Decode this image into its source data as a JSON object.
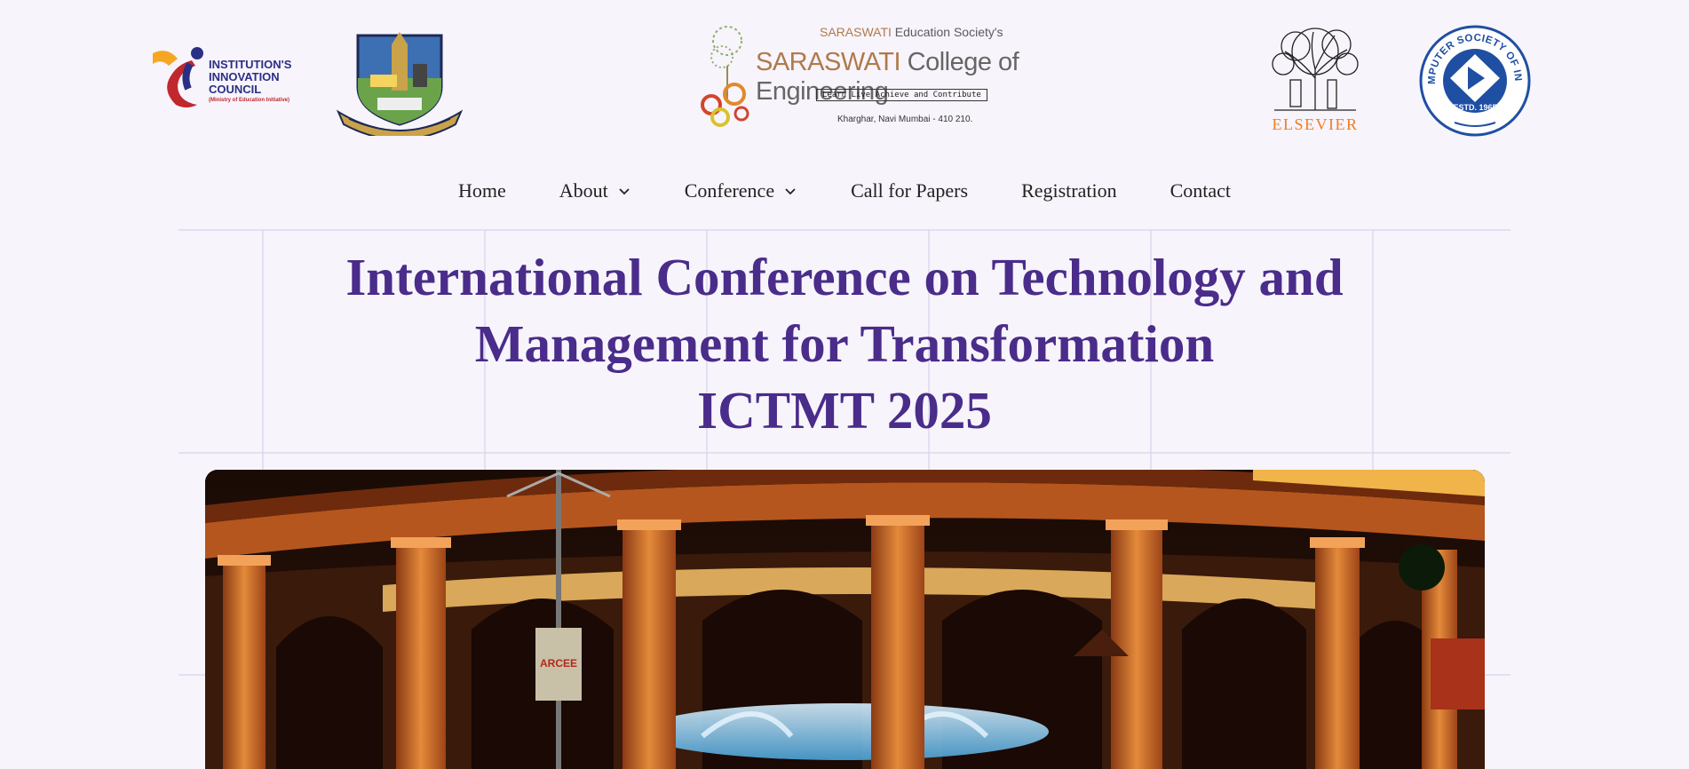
{
  "header": {
    "logos": {
      "iic": {
        "lines": [
          "INSTITUTION'S",
          "INNOVATION",
          "COUNCIL"
        ],
        "sub": "(Ministry of Education Initiative)"
      },
      "university_crest": "university-crest-icon",
      "college": {
        "society_brand": "SARASWATI",
        "society_rest": " Education Society's",
        "college_brand": "SARASWATI",
        "college_rest": " College of Engineering",
        "motto": "Learn Live Achieve and Contribute",
        "address": "Kharghar, Navi Mumbai - 410 210."
      },
      "elsevier": {
        "word": "ELSEVIER"
      },
      "csi": {
        "ring_text": "COMPUTER SOCIETY OF INDIA",
        "estd": "ESTD. 1965"
      }
    }
  },
  "nav": {
    "items": [
      {
        "label": "Home"
      },
      {
        "label": "About",
        "dropdown": true
      },
      {
        "label": "Conference",
        "dropdown": true
      },
      {
        "label": "Call for Papers"
      },
      {
        "label": "Registration"
      },
      {
        "label": "Contact"
      }
    ]
  },
  "hero": {
    "line1": "International Conference on Technology and",
    "line2": "Management for Transformation",
    "line3": "ICTMT 2025"
  },
  "colors": {
    "background": "#f7f4fc",
    "title": "#4a2c8a",
    "elsevier": "#f07d1f",
    "csi": "#1f4fa3"
  }
}
